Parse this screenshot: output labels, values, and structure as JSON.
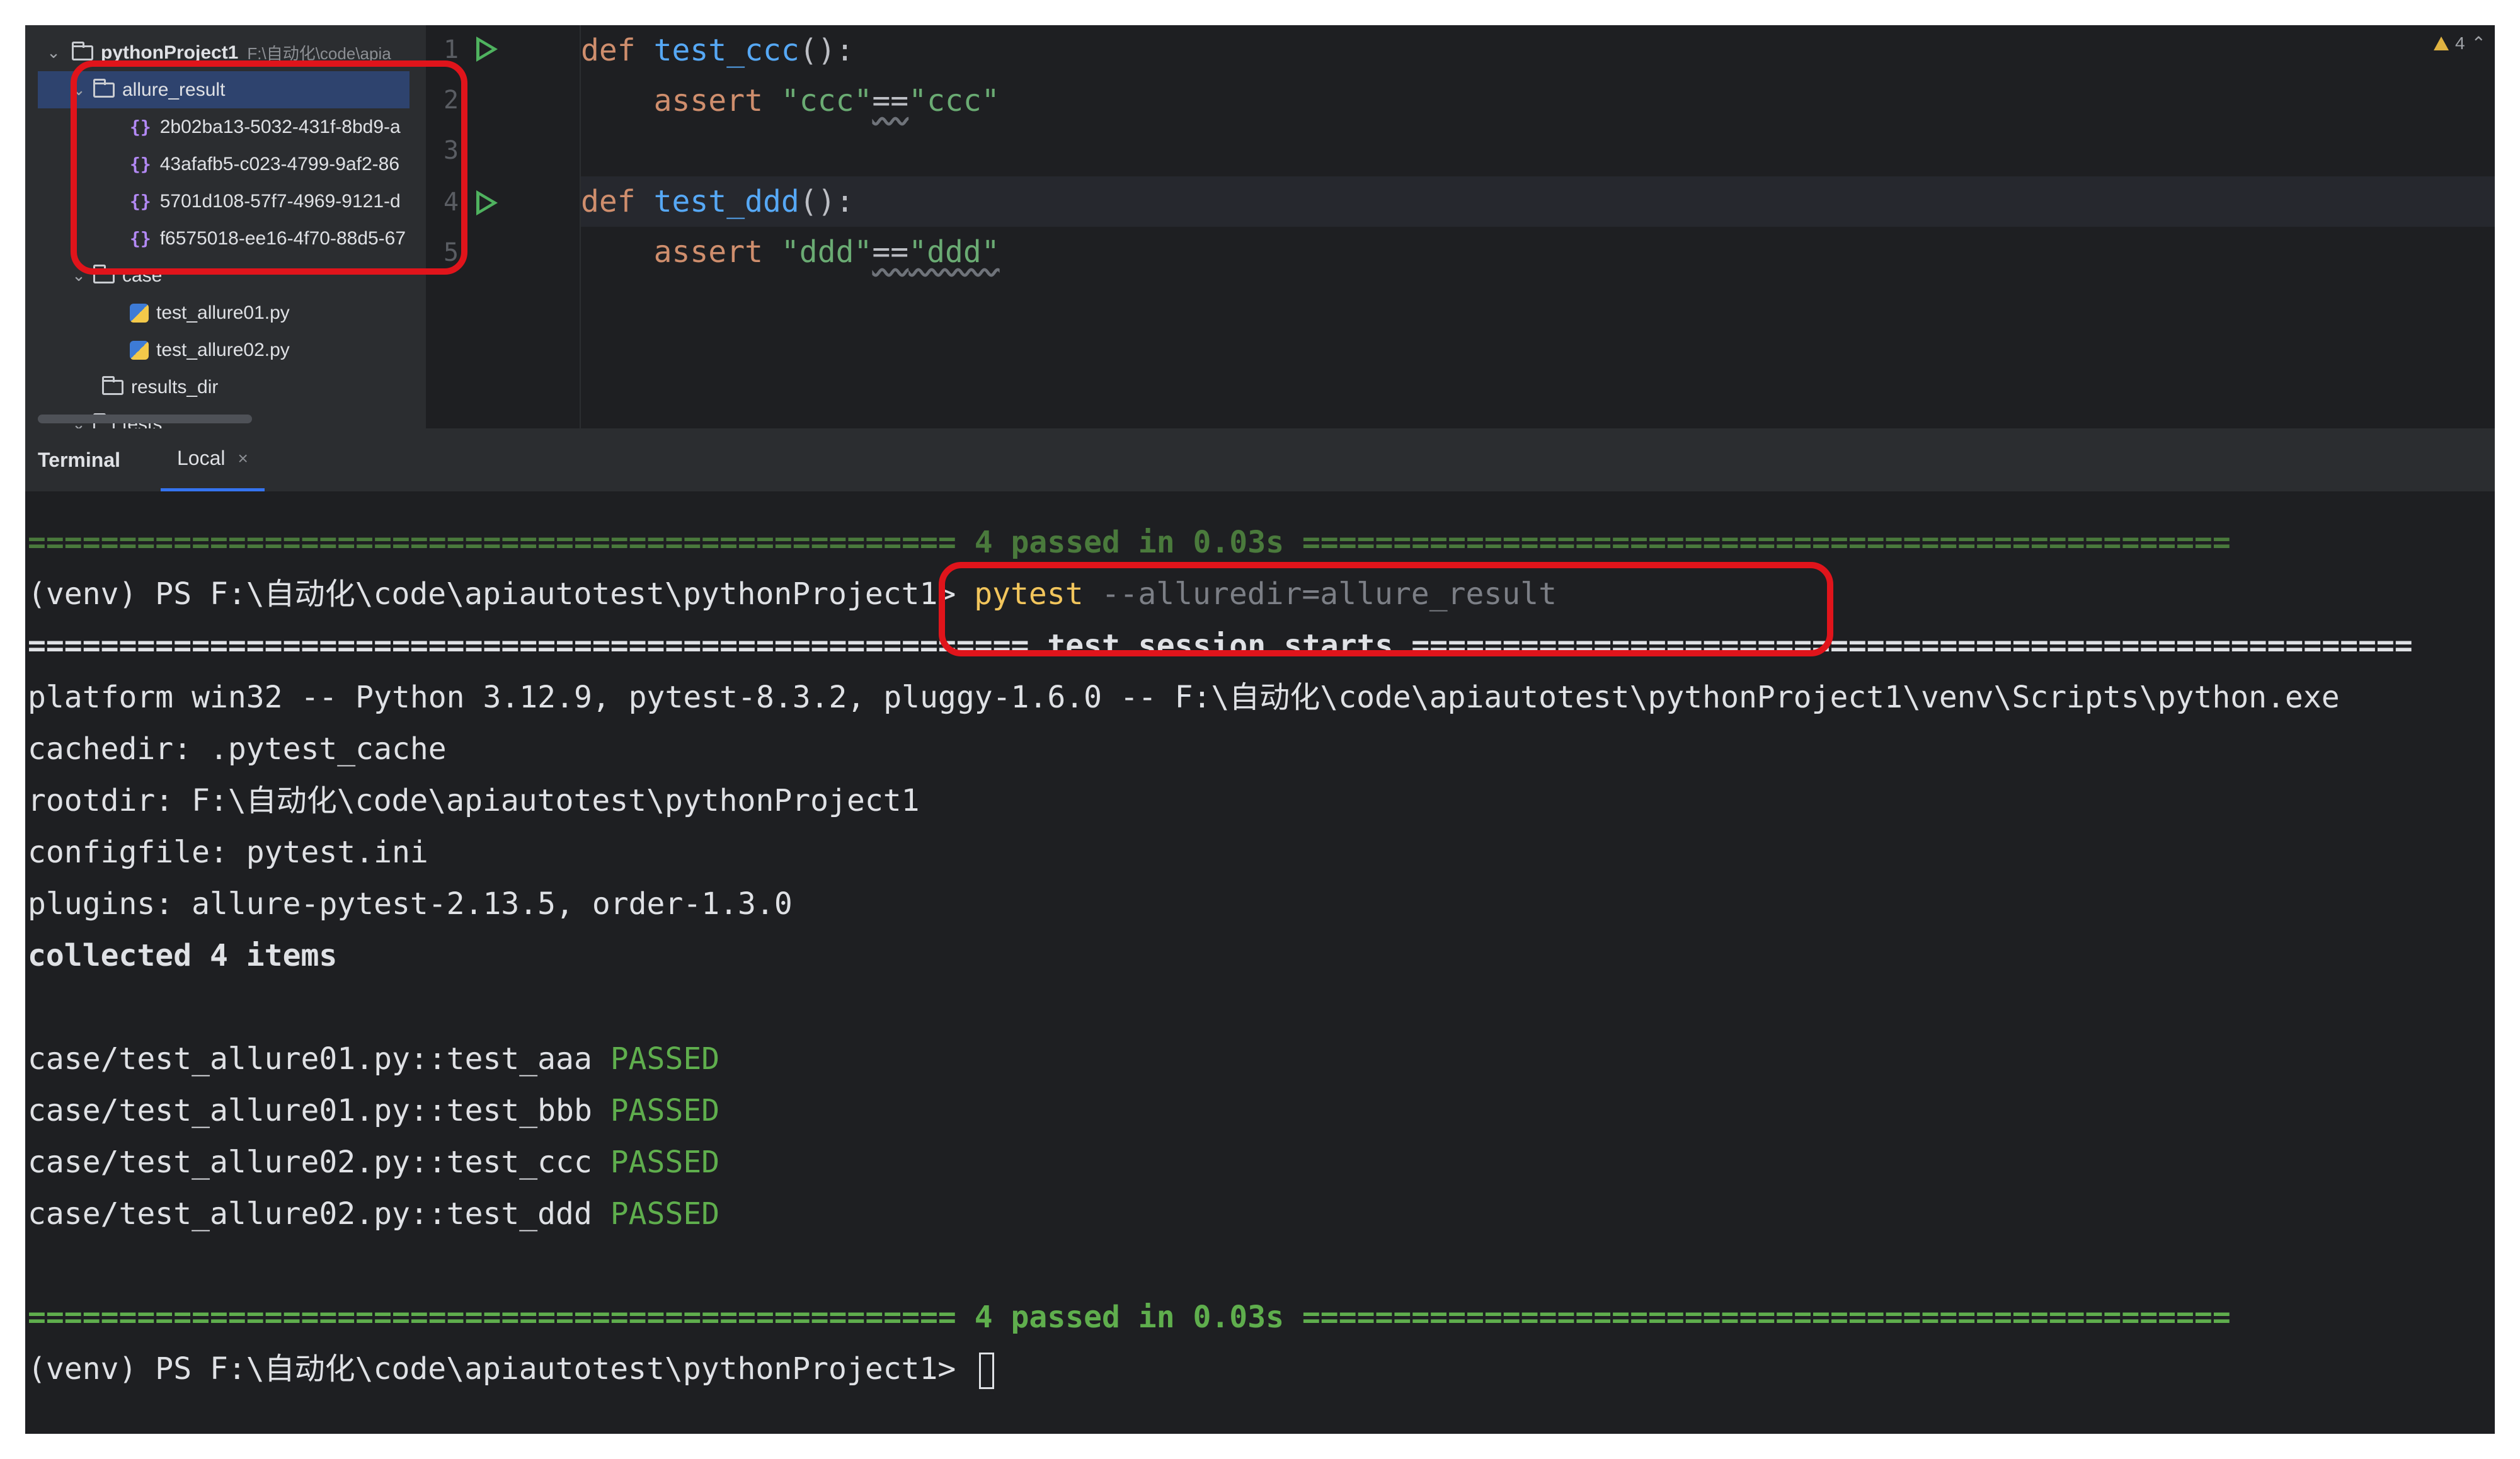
{
  "project_tree": {
    "root": {
      "name": "pythonProject1",
      "path_hint": "F:\\自动化\\code\\apia"
    },
    "allure_result": {
      "name": "allure_result",
      "files": [
        "2b02ba13-5032-431f-8bd9-a",
        "43afafb5-c023-4799-9af2-86",
        "5701d108-57f7-4969-9121-d",
        "f6575018-ee16-4f70-88d5-67"
      ]
    },
    "case_folder": "case",
    "case_files": [
      "test_allure01.py",
      "test_allure02.py"
    ],
    "results_dir": "results_dir",
    "tests": "tests"
  },
  "editor": {
    "line_numbers": [
      "1",
      "2",
      "3",
      "4",
      "5"
    ],
    "kw_def": "def",
    "kw_assert": "assert",
    "func1": "test_ccc",
    "func2": "test_ddd",
    "parens": "():",
    "assert1": {
      "left": "\"ccc\"",
      "op": "==",
      "right": "\"ccc\""
    },
    "assert2": {
      "left": "\"ddd\"",
      "op": "==",
      "right": "\"ddd\""
    },
    "inspection_count": "4"
  },
  "terminal": {
    "tabs": {
      "title": "Terminal",
      "local": "Local",
      "close": "×"
    },
    "sep_passed": "=================================================== 4 passed in 0.03s ===================================================",
    "prompt": "(venv) PS F:\\自动化\\code\\apiautotest\\pythonProject1> ",
    "cmd": "pytest",
    "cmd_args": " --alluredir=allure_result",
    "sep_session": "======================================================= test session starts =======================================================",
    "platform": "platform win32 -- Python 3.12.9, pytest-8.3.2, pluggy-1.6.0 -- F:\\自动化\\code\\apiautotest\\pythonProject1\\venv\\Scripts\\python.exe",
    "cachedir": "cachedir: .pytest_cache",
    "rootdir": "rootdir: F:\\自动化\\code\\apiautotest\\pythonProject1",
    "configfile": "configfile: pytest.ini",
    "plugins": "plugins: allure-pytest-2.13.5, order-1.3.0",
    "collected": "collected 4 items",
    "results": [
      {
        "test": "case/test_allure01.py::test_aaa ",
        "status": "PASSED"
      },
      {
        "test": "case/test_allure01.py::test_bbb ",
        "status": "PASSED"
      },
      {
        "test": "case/test_allure02.py::test_ccc ",
        "status": "PASSED"
      },
      {
        "test": "case/test_allure02.py::test_ddd ",
        "status": "PASSED"
      }
    ]
  },
  "colors": {
    "annotation": "#e0141b",
    "passed": "#5fae4d",
    "command": "#f2c55c",
    "keyword": "#cf8e6d",
    "function": "#56a8f5",
    "string": "#6aab73"
  }
}
